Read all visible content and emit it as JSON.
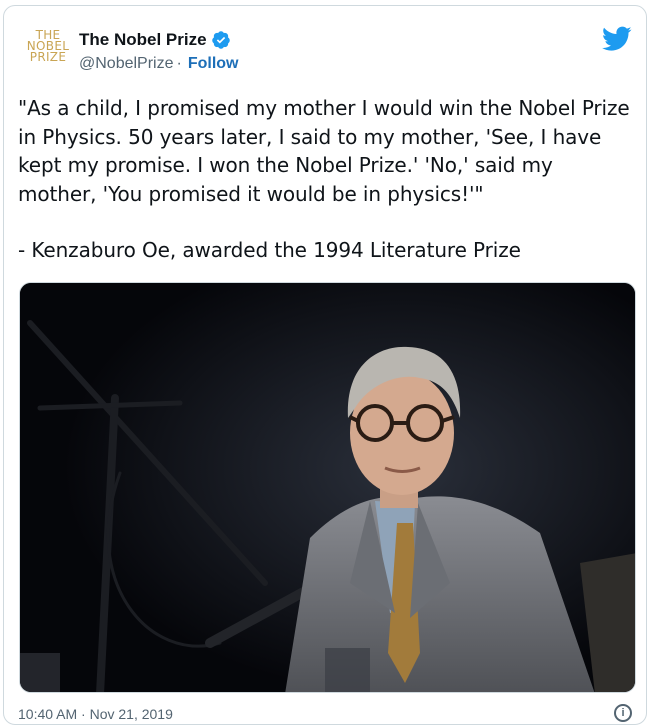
{
  "account": {
    "avatar_lines": [
      "THE",
      "NOBEL",
      "PRIZE"
    ],
    "display_name": "The Nobel Prize",
    "handle": "@NobelPrize",
    "separator": "·",
    "follow_label": "Follow",
    "verified": true
  },
  "icons": {
    "brand": "twitter-bird-icon",
    "verified": "verified-badge-icon",
    "info": "info-icon"
  },
  "tweet": {
    "quote": "\"As a child, I promised my mother I would win the Nobel Prize in Physics. 50 years later, I said to my mother, 'See, I have kept my promise. I won the Nobel Prize.' 'No,' said my mother, 'You promised it would be in physics!'\"",
    "attribution": "- Kenzaburo Oe, awarded the 1994 Literature Prize"
  },
  "footer": {
    "timestamp": "10:40 AM · Nov 21, 2019",
    "info_label": "i"
  },
  "colors": {
    "avatar_gold": "#c9a554",
    "verified_blue": "#1d9bf0",
    "twitter_blue": "#1d9bf0",
    "follow_blue": "#1d6fb8",
    "secondary_text": "#536471"
  }
}
